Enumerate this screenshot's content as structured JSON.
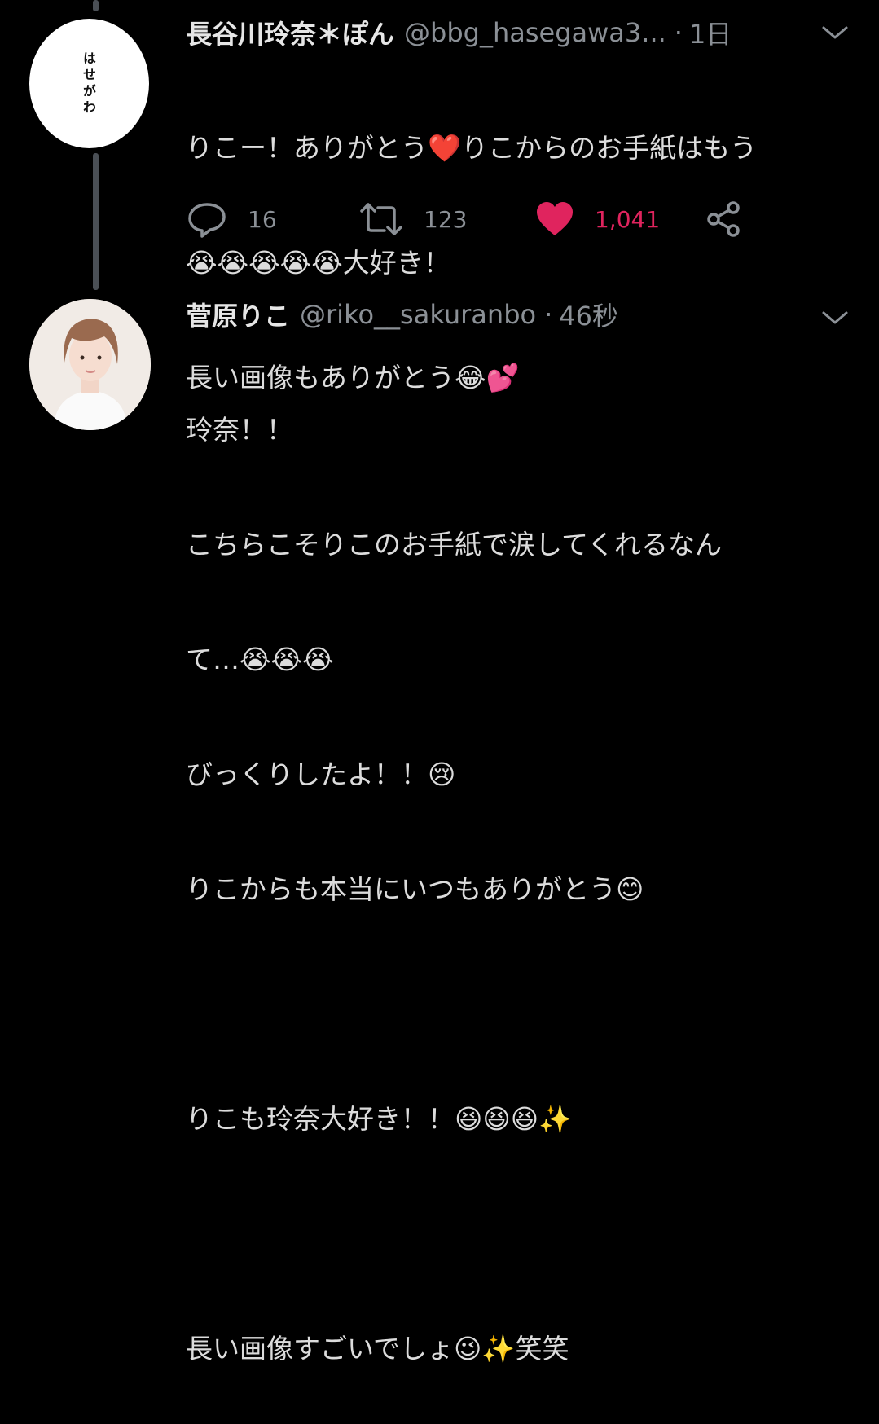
{
  "thread": [
    {
      "display_name": "長谷川玲奈＊ぽん",
      "handle": "@bbg_hasegawa3...",
      "separator": "·",
      "time": "1日",
      "avatar_text": "はせがわ",
      "body": [
        "りこー！ありがとう❤️りこからのお手紙はもう",
        "😭😭😭😭😭大好き！",
        "長い画像もありがとう😂💕"
      ],
      "actions": {
        "reply_count": "16",
        "retweet_count": "123",
        "like_count": "1,041",
        "liked": true
      }
    },
    {
      "display_name": "菅原りこ",
      "handle": "@riko__sakuranbo",
      "separator": "·",
      "time": "46秒",
      "body": [
        "玲奈！！",
        "こちらこそりこのお手紙で涙してくれるなん",
        "て…😭😭😭",
        "びっくりしたよ！！😢",
        "りこからも本当にいつもありがとう😊",
        "",
        "りこも玲奈大好き！！😆😆😆✨",
        "",
        "長い画像すごいでしょ😉✨笑笑"
      ]
    }
  ],
  "icons": [
    "reply-icon",
    "retweet-icon",
    "like-icon",
    "share-icon",
    "chevron-down-icon"
  ],
  "colors": {
    "background": "#000000",
    "like": "#e0245e",
    "muted": "#8b9096",
    "text": "#dcdcdc",
    "thread_line": "#4a4f55"
  }
}
